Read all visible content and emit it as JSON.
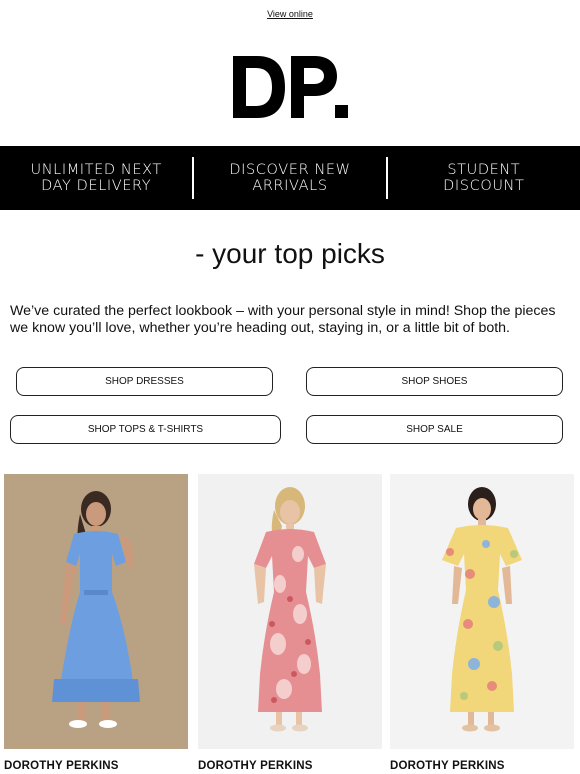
{
  "header": {
    "view_online": "View online"
  },
  "logo": {
    "text": "DP."
  },
  "usp": [
    {
      "label": "UNLIMITED NEXT\nDAY DELIVERY"
    },
    {
      "label": "DISCOVER NEW\nARRIVALS"
    },
    {
      "label": "STUDENT\nDISCOUNT"
    }
  ],
  "headline": "- your top picks",
  "intro": "We’ve curated the perfect lookbook – with your personal style in mind! Shop the pieces we know you’ll love, whether you’re heading out, staying in, or a little bit of both.",
  "buttons": {
    "dresses": "SHOP DRESSES",
    "shoes": "SHOP SHOES",
    "tops": "SHOP TOPS & T-SHIRTS",
    "sale": "SHOP SALE"
  },
  "products": [
    {
      "brand": "DOROTHY PERKINS",
      "bg": "#b9a184",
      "dress": "#6d9fe0"
    },
    {
      "brand": "DOROTHY PERKINS",
      "bg": "#f1f1f1",
      "dress": "#e68f93"
    },
    {
      "brand": "DOROTHY PERKINS",
      "bg": "#f3f3f3",
      "dress": "#f1d67a"
    }
  ],
  "colors": {
    "bar": "#000000",
    "text": "#111111"
  }
}
